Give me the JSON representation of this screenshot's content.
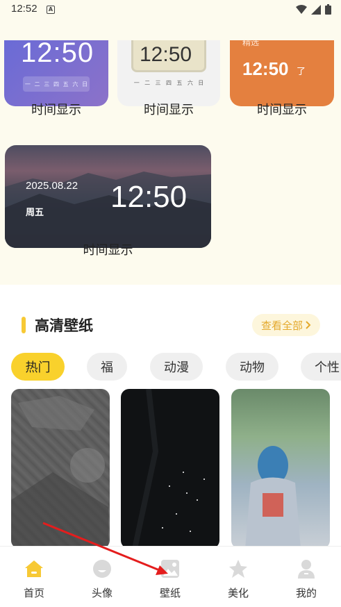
{
  "status": {
    "time": "12:52",
    "badge": "A"
  },
  "widgets": [
    {
      "time": "12:50",
      "week": [
        "一",
        "二",
        "三",
        "四",
        "五",
        "六",
        "日"
      ],
      "label": "时间显示"
    },
    {
      "time": "12:50",
      "week": [
        "一",
        "二",
        "三",
        "四",
        "五",
        "六",
        "日"
      ],
      "label": "时间显示"
    },
    {
      "sub": "精选",
      "time": "12:50",
      "tail": "了",
      "label": "时间显示"
    },
    {
      "date": "2025.08.22",
      "day": "周五",
      "time": "12:50",
      "label": "时间显示"
    }
  ],
  "section": {
    "title": "高清壁纸",
    "view_all": "查看全部"
  },
  "categories": [
    "热门",
    "福",
    "动漫",
    "动物",
    "个性"
  ],
  "tabbar": [
    {
      "label": "首页",
      "icon": "home-icon"
    },
    {
      "label": "头像",
      "icon": "avatar-icon"
    },
    {
      "label": "壁纸",
      "icon": "wallpaper-icon"
    },
    {
      "label": "美化",
      "icon": "beautify-icon"
    },
    {
      "label": "我的",
      "icon": "profile-icon"
    }
  ],
  "colors": {
    "accent": "#f9d12c",
    "active_tab": "#f7c935",
    "inactive_tab": "#d9d9d9"
  }
}
